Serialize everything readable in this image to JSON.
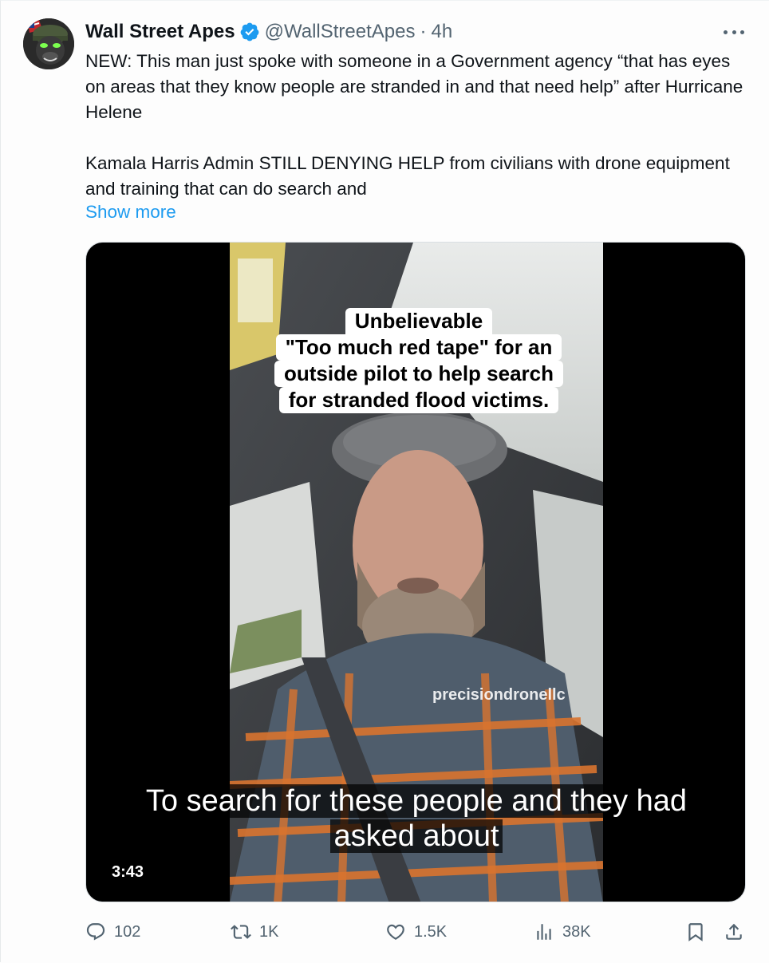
{
  "tweet": {
    "author_name": "Wall Street Apes",
    "author_handle": "@WallStreetApes",
    "separator": "·",
    "timestamp": "4h",
    "text_paragraph_1": "NEW: This man just spoke with someone in a Government agency “that has eyes on areas that they know people are stranded in and that need help” after Hurricane Helene",
    "text_paragraph_2": "Kamala Harris Admin STILL DENYING HELP from civilians with drone equipment and training that can do search and",
    "show_more_label": "Show more"
  },
  "video": {
    "caption_lines": [
      "Unbelievable",
      "\"Too much red tape\" for an",
      "outside pilot to help search",
      "for stranded flood victims."
    ],
    "watermark": "precisiondronellc",
    "subtitle_line_1": "To search for these people and they had",
    "subtitle_line_2": "asked about",
    "duration": "3:43"
  },
  "actions": {
    "replies": "102",
    "reposts": "1K",
    "likes": "1.5K",
    "views": "38K"
  },
  "colors": {
    "accent": "#1d9bf0",
    "text_primary": "#0f1419",
    "text_secondary": "#536471"
  },
  "icons": [
    "verified-badge-icon",
    "more-icon",
    "reply-icon",
    "retweet-icon",
    "like-icon",
    "views-icon",
    "bookmark-icon",
    "share-icon"
  ]
}
